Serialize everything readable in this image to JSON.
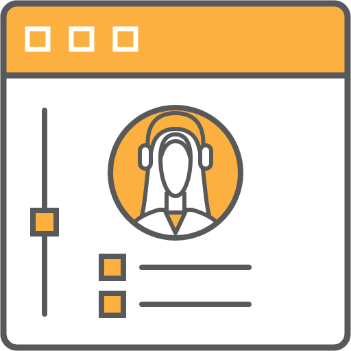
{
  "icon_name": "user-profile-window-icon",
  "colors": {
    "accent": "#FBB040",
    "stroke": "#58595B",
    "background": "#FFFFFF"
  },
  "window": {
    "title_bar_buttons": [
      "window-control",
      "window-control",
      "window-control"
    ]
  },
  "sidebar": {
    "slider": {
      "level": 0.45
    }
  },
  "content": {
    "avatar_icon": "user-avatar-icon",
    "list_items": [
      {
        "checkbox": "checkbox-icon",
        "line": "text-line-placeholder"
      },
      {
        "checkbox": "checkbox-icon",
        "line": "text-line-placeholder"
      }
    ]
  }
}
